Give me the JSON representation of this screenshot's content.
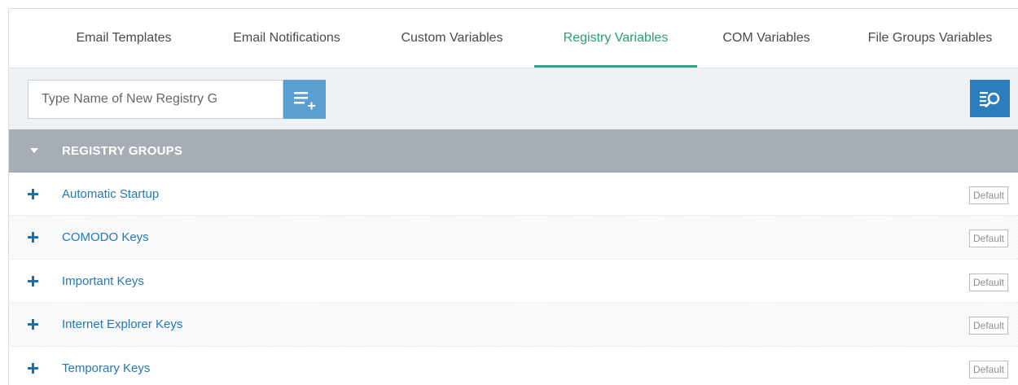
{
  "tabs": [
    {
      "label": "Email Templates"
    },
    {
      "label": "Email Notifications"
    },
    {
      "label": "Custom Variables"
    },
    {
      "label": "Registry Variables",
      "active": true
    },
    {
      "label": "COM Variables"
    },
    {
      "label": "File Groups Variables"
    }
  ],
  "toolbar": {
    "input_placeholder": "Type Name of New Registry G",
    "input_value": "",
    "add_icon": "add-list-icon",
    "search_icon": "filter-search-icon"
  },
  "group": {
    "title": "REGISTRY GROUPS",
    "icon": "caret-down-icon"
  },
  "rows": [
    {
      "label": "Automatic Startup",
      "badge": "Default"
    },
    {
      "label": "COMODO Keys",
      "badge": "Default"
    },
    {
      "label": "Important Keys",
      "badge": "Default"
    },
    {
      "label": "Internet Explorer Keys",
      "badge": "Default"
    },
    {
      "label": "Temporary Keys",
      "badge": "Default"
    }
  ],
  "colors": {
    "active_tab": "#2a9d7c",
    "link": "#2677b4",
    "header_bg": "#a7adb4",
    "add_button": "#5a9fcf",
    "search_button": "#2b7dbb"
  }
}
